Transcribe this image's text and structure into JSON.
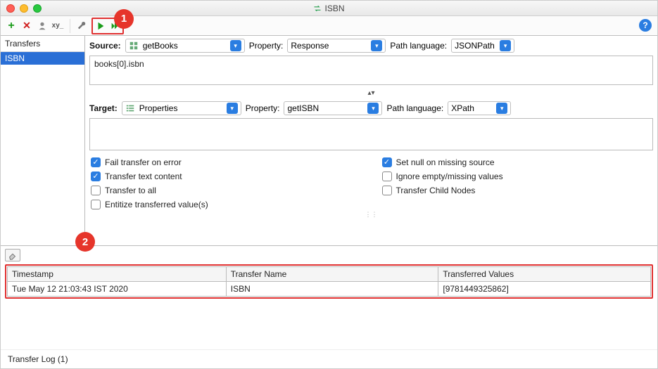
{
  "window": {
    "title": "ISBN"
  },
  "toolbar": {
    "add": "+",
    "remove": "✕",
    "clone_hint": "clone",
    "rename_hint": "xy_"
  },
  "callouts": {
    "run": "1",
    "log": "2"
  },
  "sidebar": {
    "header": "Transfers",
    "items": [
      {
        "label": "ISBN",
        "selected": true
      }
    ]
  },
  "source": {
    "label": "Source:",
    "step": "getBooks",
    "property_label": "Property:",
    "property": "Response",
    "pathlang_label": "Path language:",
    "pathlang": "JSONPath",
    "expression": "books[0].isbn"
  },
  "target": {
    "label": "Target:",
    "step": "Properties",
    "property_label": "Property:",
    "property": "getISBN",
    "pathlang_label": "Path language:",
    "pathlang": "XPath",
    "expression": ""
  },
  "options": {
    "fail_on_error": {
      "label": "Fail transfer on error",
      "checked": true
    },
    "set_null": {
      "label": "Set null on missing source",
      "checked": true
    },
    "text_content": {
      "label": "Transfer text content",
      "checked": true
    },
    "ignore_missing": {
      "label": "Ignore empty/missing values",
      "checked": false
    },
    "transfer_all": {
      "label": "Transfer to all",
      "checked": false
    },
    "child_nodes": {
      "label": "Transfer Child Nodes",
      "checked": false
    },
    "entitize": {
      "label": "Entitize transferred value(s)",
      "checked": false
    }
  },
  "log": {
    "headers": {
      "ts": "Timestamp",
      "name": "Transfer Name",
      "vals": "Transferred Values"
    },
    "rows": [
      {
        "ts": "Tue May 12 21:03:43 IST 2020",
        "name": "ISBN",
        "vals": "[9781449325862]"
      }
    ],
    "footer": "Transfer Log (1)"
  }
}
